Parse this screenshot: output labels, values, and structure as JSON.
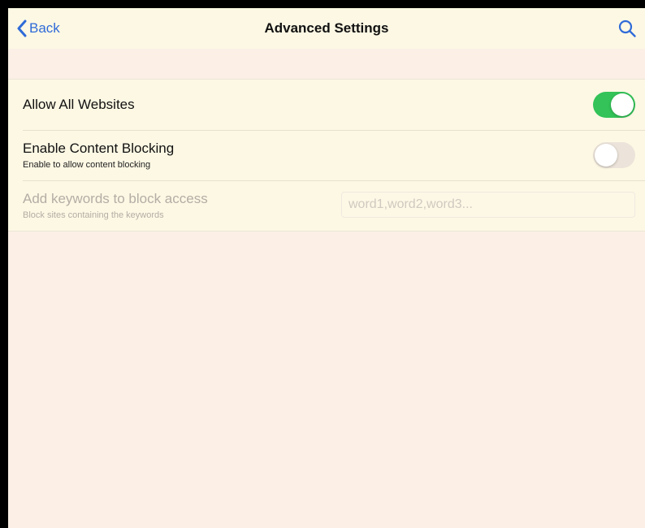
{
  "navbar": {
    "back_label": "Back",
    "title": "Advanced Settings",
    "search_icon": "search-icon",
    "back_icon": "chevron-left-icon"
  },
  "settings": [
    {
      "title": "Allow All Websites",
      "subtitle": "",
      "control": "toggle",
      "state": "on"
    },
    {
      "title": "Enable Content Blocking",
      "subtitle": "Enable to allow content blocking",
      "control": "toggle",
      "state": "off"
    },
    {
      "title": "Add keywords to block access",
      "subtitle": "Block sites containing the keywords",
      "control": "text-input",
      "value": "",
      "placeholder": "word1,word2,word3...",
      "enabled": false
    }
  ],
  "colors": {
    "accent": "#2f6bd8",
    "toggle_on": "#33c358",
    "toggle_off": "#ece4da",
    "background": "#fcf0e6",
    "row_background": "#fdf8e4"
  }
}
